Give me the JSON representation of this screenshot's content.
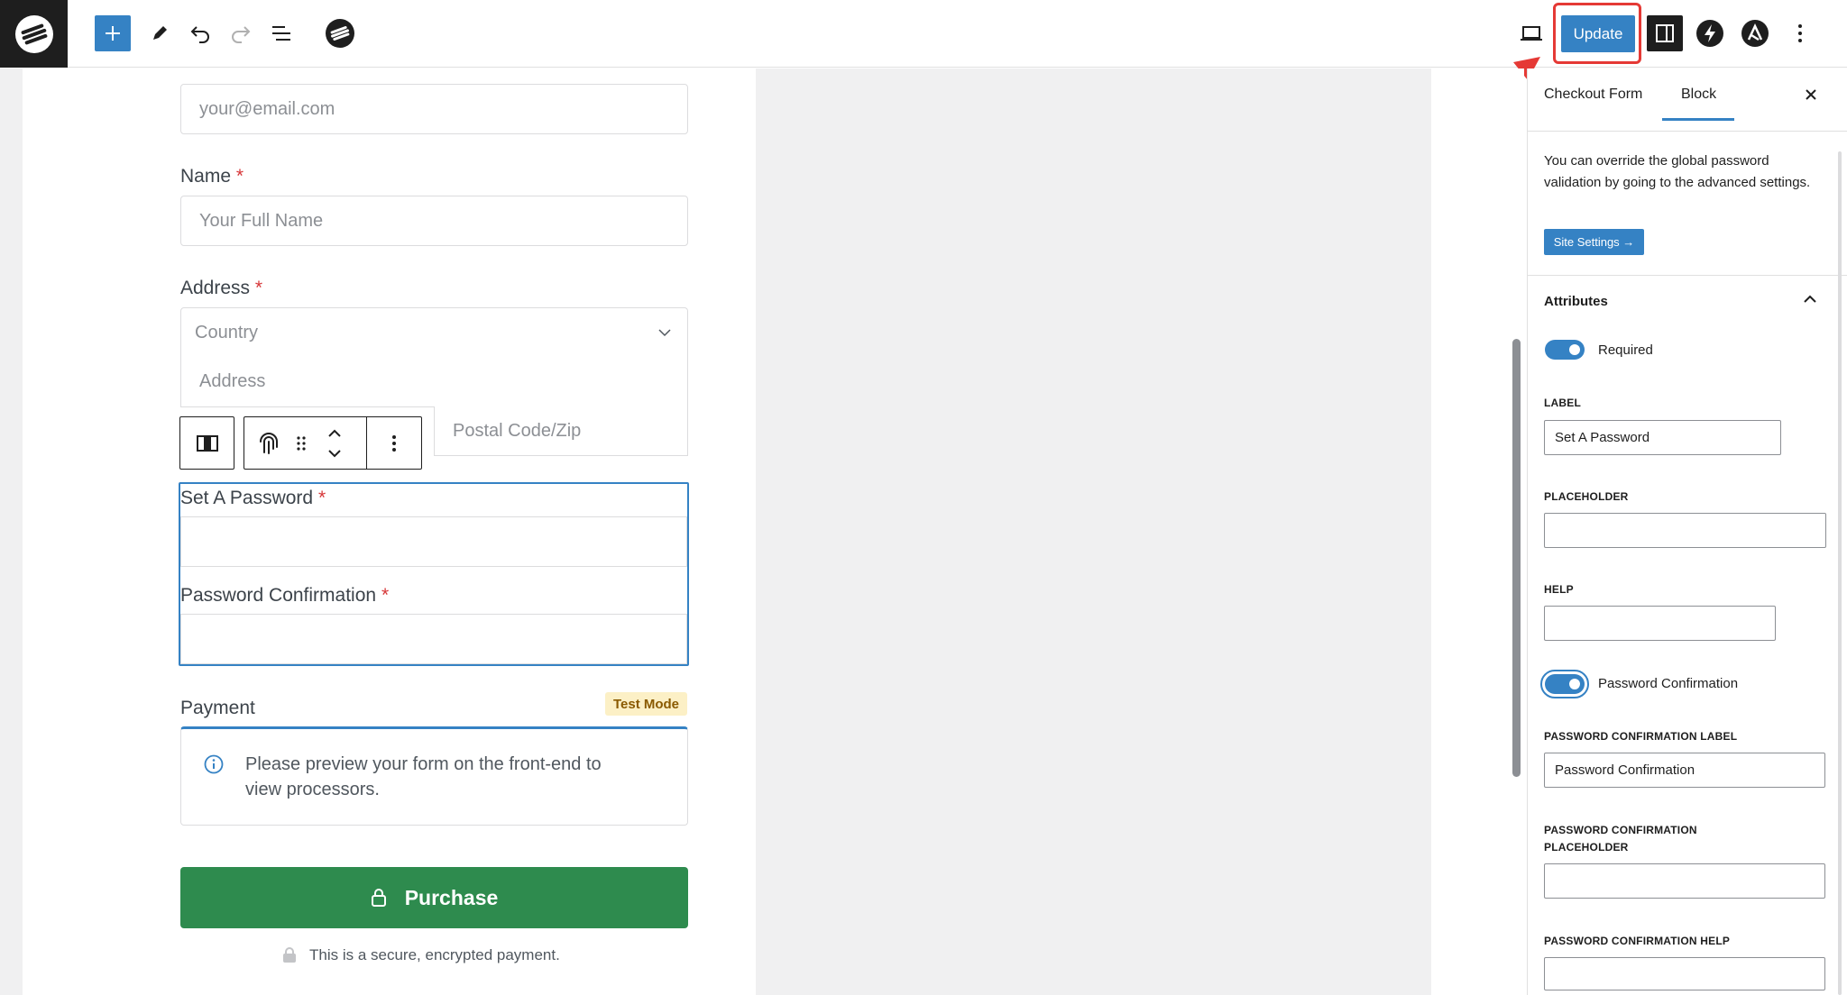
{
  "toolbar": {
    "update_label": "Update"
  },
  "form": {
    "email_placeholder": "your@email.com",
    "name_label": "Name",
    "name_placeholder": "Your Full Name",
    "address_label": "Address",
    "country_placeholder": "Country",
    "address_placeholder": "Address",
    "postal_placeholder": "Postal Code/Zip",
    "required_mark": "*",
    "password_label": "Set A Password",
    "password_confirm_label": "Password Confirmation",
    "payment_label": "Payment",
    "test_mode_badge": "Test Mode",
    "payment_note": "Please preview your form on the front-end to view processors.",
    "purchase_label": "Purchase",
    "secure_note": "This is a secure, encrypted payment."
  },
  "sidebar": {
    "tabs": [
      "Checkout Form",
      "Block"
    ],
    "active_tab": "Block",
    "info_text": "You can override the global password validation by going to the advanced settings.",
    "site_settings_button": "Site Settings →",
    "attributes_heading": "Attributes",
    "required_toggle_label": "Required",
    "required_on": true,
    "label_caption": "LABEL",
    "label_value": "Set A Password",
    "placeholder_caption": "PLACEHOLDER",
    "placeholder_value": "",
    "help_caption": "HELP",
    "help_value": "",
    "pw_confirm_toggle_label": "Password Confirmation",
    "pw_confirm_on": true,
    "pw_confirm_label_caption": "PASSWORD CONFIRMATION LABEL",
    "pw_confirm_label_value": "Password Confirmation",
    "pw_confirm_placeholder_caption_1": "PASSWORD CONFIRMATION",
    "pw_confirm_placeholder_caption_2": "PLACEHOLDER",
    "pw_confirm_placeholder_value": "",
    "pw_confirm_help_caption": "PASSWORD CONFIRMATION HELP",
    "pw_confirm_help_value": ""
  },
  "icons": [
    "site-logo-icon",
    "plus-icon",
    "pencil-icon",
    "undo-icon",
    "redo-icon",
    "list-view-icon",
    "surecart-icon",
    "desktop-preview-icon",
    "sidebar-toggle-icon",
    "lightning-icon",
    "astra-icon",
    "more-vertical-icon",
    "close-icon",
    "chevron-up-icon",
    "chevron-down-icon",
    "fingerprint-icon",
    "drag-handle-icon",
    "info-icon",
    "lock-icon"
  ],
  "colors": {
    "accent": "#3582c4",
    "purchase_green": "#2e8b4e",
    "required_red": "#d63638",
    "highlight_red": "#e53935"
  }
}
